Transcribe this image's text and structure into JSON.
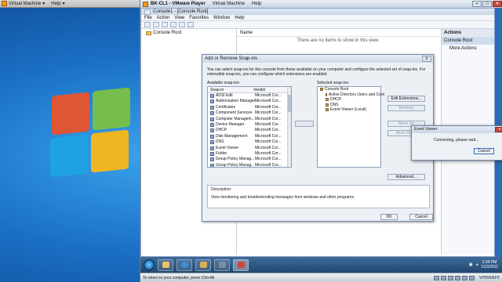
{
  "host": {
    "menu_label": "Virtual Machine",
    "help_label": "Help"
  },
  "player": {
    "title": "BK-CL1 - VMware Player",
    "menu_vm": "Virtual Machine",
    "menu_help": "Help",
    "status_text": "To return to your computer, press Ctrl+Alt",
    "brand": "vmware"
  },
  "mmc": {
    "title": "Console1 - [Console Root]",
    "menu": [
      "File",
      "Action",
      "View",
      "Favorites",
      "Window",
      "Help"
    ],
    "tree_root": "Console Root",
    "list_column": "Name",
    "empty_message": "There are no items to show in this view.",
    "actions_header": "Actions",
    "actions_sub": "Console Root",
    "actions_more": "More Actions"
  },
  "snapin_dialog": {
    "title": "Add or Remove Snap-ins",
    "close_label": "x",
    "intro": "You can select snap-ins for this console from those available on your computer and configure the selected set of snap-ins. For extensible snap-ins, you can configure which extensions are enabled.",
    "available_label": "Available snap-ins:",
    "selected_label": "Selected snap-ins:",
    "col_snapin": "Snap-in",
    "col_vendor": "Vendor",
    "available": [
      {
        "name": "ADSI Edit",
        "vendor": "Microsoft Cor..."
      },
      {
        "name": "Authorization Manager",
        "vendor": "Microsoft Cor..."
      },
      {
        "name": "Certificates",
        "vendor": "Microsoft Cor..."
      },
      {
        "name": "Component Services",
        "vendor": "Microsoft Cor..."
      },
      {
        "name": "Computer Managem...",
        "vendor": "Microsoft Cor..."
      },
      {
        "name": "Device Manager",
        "vendor": "Microsoft Cor..."
      },
      {
        "name": "DHCP",
        "vendor": "Microsoft Cor..."
      },
      {
        "name": "Disk Management",
        "vendor": "Microsoft Cor..."
      },
      {
        "name": "DNS",
        "vendor": "Microsoft Cor..."
      },
      {
        "name": "Event Viewer",
        "vendor": "Microsoft Cor..."
      },
      {
        "name": "Folder",
        "vendor": "Microsoft Cor..."
      },
      {
        "name": "Group Policy Manag...",
        "vendor": "Microsoft Cor..."
      },
      {
        "name": "Group Policy Manag...",
        "vendor": "Microsoft Cor..."
      }
    ],
    "selected": [
      "Console Root",
      "Active Directory Users and Com",
      "DHCP",
      "DNS",
      "Event Viewer (Local)"
    ],
    "edit_extensions": "Edit Extensions...",
    "remove": "Remove",
    "move_up": "Move Up",
    "move_down": "Move Down",
    "advanced": "Advanced...",
    "description_label": "Description:",
    "description": "View monitoring and troubleshooting messages from windows and other programs.",
    "ok": "OK",
    "cancel": "Cancel"
  },
  "event_viewer_popup": {
    "title": "Event Viewer",
    "close_label": "x",
    "message": "Connecting, please wait...",
    "cancel": "Cancel"
  },
  "taskbar": {
    "time": "2:34 PM",
    "date": "1/16/2011"
  }
}
